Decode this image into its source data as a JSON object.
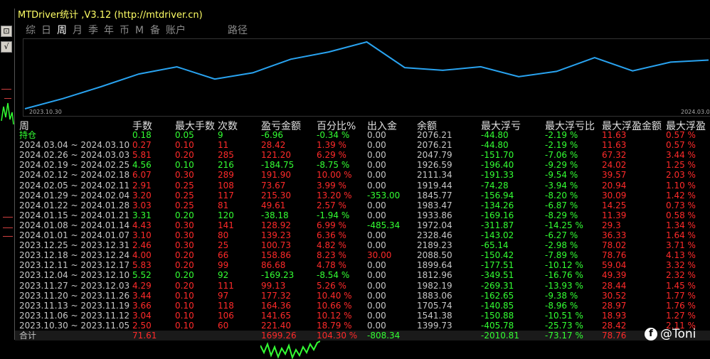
{
  "window": {
    "title": "MTDriver统计 ,V3.12 (http://mtdriver.cn)"
  },
  "side_buttons": [
    "⊡",
    "√"
  ],
  "tabs": [
    {
      "label": "综",
      "active": false
    },
    {
      "label": "日",
      "active": false
    },
    {
      "label": "周",
      "active": true
    },
    {
      "label": "月",
      "active": false
    },
    {
      "label": "季",
      "active": false
    },
    {
      "label": "年",
      "active": false
    },
    {
      "label": "币",
      "active": false
    },
    {
      "label": "M",
      "active": false
    },
    {
      "label": "备",
      "active": false
    },
    {
      "label": "账户",
      "active": false
    },
    {
      "label": "路径",
      "active": false
    }
  ],
  "chart_data": {
    "type": "line",
    "x_start_label": "2023.10.30",
    "x_end_label": "2024.03.0",
    "series": [
      {
        "color": "#29a3f0",
        "values": [
          1399.73,
          1541.38,
          1705.74,
          1883.06,
          1982.19,
          1812.96,
          1899.64,
          2088.5,
          2189.23,
          2328.46,
          1972.04,
          1933.86,
          1983.47,
          1845.77,
          1919.44,
          2111.34,
          1926.59,
          2047.79,
          2076.21
        ]
      }
    ]
  },
  "table": {
    "headers": [
      "周",
      "手数",
      "最大手数",
      "次数",
      "盈亏金额",
      "百分比%",
      "出入金",
      "余额",
      "最大浮亏",
      "最大浮亏比",
      "最大浮盈金额",
      "最大浮盈"
    ],
    "rows": [
      {
        "period": "持仓",
        "lots": "0.18",
        "max_lots": "0.05",
        "count": "9",
        "pnl": "-6.96",
        "pct": "-0.34 %",
        "deposit": "0.00",
        "balance": "2076.21",
        "max_float_loss": "-44.80",
        "max_float_loss_pct": "-2.19 %",
        "max_float_profit": "11.63",
        "max_float_profit_pct": "0.57 %",
        "pnl_color": "green"
      },
      {
        "period": "2024.03.04 ~ 2024.03.10",
        "lots": "0.27",
        "max_lots": "0.10",
        "count": "11",
        "pnl": "28.42",
        "pct": "1.39 %",
        "deposit": "0.00",
        "balance": "2076.21",
        "max_float_loss": "-44.80",
        "max_float_loss_pct": "-2.19 %",
        "max_float_profit": "11.63",
        "max_float_profit_pct": "0.57 %",
        "pnl_color": "red"
      },
      {
        "period": "2024.02.26 ~ 2024.03.03",
        "lots": "5.81",
        "max_lots": "0.20",
        "count": "285",
        "pnl": "121.20",
        "pct": "6.29 %",
        "deposit": "0.00",
        "balance": "2047.79",
        "max_float_loss": "-151.70",
        "max_float_loss_pct": "-7.06 %",
        "max_float_profit": "67.32",
        "max_float_profit_pct": "3.44 %",
        "pnl_color": "red"
      },
      {
        "period": "2024.02.19 ~ 2024.02.25",
        "lots": "4.56",
        "max_lots": "0.10",
        "count": "216",
        "pnl": "-184.75",
        "pct": "-8.75 %",
        "deposit": "0.00",
        "balance": "1926.59",
        "max_float_loss": "-196.40",
        "max_float_loss_pct": "-9.29 %",
        "max_float_profit": "24.02",
        "max_float_profit_pct": "1.25 %",
        "pnl_color": "green"
      },
      {
        "period": "2024.02.12 ~ 2024.02.18",
        "lots": "6.07",
        "max_lots": "0.30",
        "count": "289",
        "pnl": "191.90",
        "pct": "10.00 %",
        "deposit": "0.00",
        "balance": "2111.34",
        "max_float_loss": "-191.33",
        "max_float_loss_pct": "-9.54 %",
        "max_float_profit": "39.57",
        "max_float_profit_pct": "2.03 %",
        "pnl_color": "red"
      },
      {
        "period": "2024.02.05 ~ 2024.02.11",
        "lots": "2.91",
        "max_lots": "0.25",
        "count": "108",
        "pnl": "73.67",
        "pct": "3.99 %",
        "deposit": "0.00",
        "balance": "1919.44",
        "max_float_loss": "-74.28",
        "max_float_loss_pct": "-3.94 %",
        "max_float_profit": "20.94",
        "max_float_profit_pct": "1.10 %",
        "pnl_color": "red"
      },
      {
        "period": "2024.01.29 ~ 2024.02.04",
        "lots": "3.20",
        "max_lots": "0.25",
        "count": "117",
        "pnl": "215.30",
        "pct": "13.20 %",
        "deposit": "-353.00",
        "balance": "1845.77",
        "max_float_loss": "-156.94",
        "max_float_loss_pct": "-8.20 %",
        "max_float_profit": "30.09",
        "max_float_profit_pct": "1.42 %",
        "pnl_color": "red",
        "deposit_color": "green"
      },
      {
        "period": "2024.01.22 ~ 2024.01.28",
        "lots": "3.03",
        "max_lots": "0.25",
        "count": "81",
        "pnl": "49.61",
        "pct": "2.57 %",
        "deposit": "0.00",
        "balance": "1983.47",
        "max_float_loss": "-134.26",
        "max_float_loss_pct": "-6.87 %",
        "max_float_profit": "14.25",
        "max_float_profit_pct": "0.73 %",
        "pnl_color": "red"
      },
      {
        "period": "2024.01.15 ~ 2024.01.21",
        "lots": "3.31",
        "max_lots": "0.20",
        "count": "120",
        "pnl": "-38.18",
        "pct": "-1.94 %",
        "deposit": "0.00",
        "balance": "1933.86",
        "max_float_loss": "-169.16",
        "max_float_loss_pct": "-8.29 %",
        "max_float_profit": "11.39",
        "max_float_profit_pct": "0.58 %",
        "pnl_color": "green"
      },
      {
        "period": "2024.01.08 ~ 2024.01.14",
        "lots": "4.43",
        "max_lots": "0.30",
        "count": "141",
        "pnl": "128.92",
        "pct": "6.99 %",
        "deposit": "-485.34",
        "balance": "1972.04",
        "max_float_loss": "-311.87",
        "max_float_loss_pct": "-14.25 %",
        "max_float_profit": "29.3",
        "max_float_profit_pct": "1.34 %",
        "pnl_color": "red",
        "deposit_color": "green"
      },
      {
        "period": "2024.01.01 ~ 2024.01.07",
        "lots": "3.10",
        "max_lots": "0.30",
        "count": "80",
        "pnl": "139.23",
        "pct": "6.36 %",
        "deposit": "0.00",
        "balance": "2328.46",
        "max_float_loss": "-143.02",
        "max_float_loss_pct": "-6.27 %",
        "max_float_profit": "36.33",
        "max_float_profit_pct": "1.64 %",
        "pnl_color": "red"
      },
      {
        "period": "2023.12.25 ~ 2023.12.31",
        "lots": "2.46",
        "max_lots": "0.30",
        "count": "25",
        "pnl": "100.73",
        "pct": "4.82 %",
        "deposit": "0.00",
        "balance": "2189.23",
        "max_float_loss": "-65.14",
        "max_float_loss_pct": "-2.98 %",
        "max_float_profit": "78.02",
        "max_float_profit_pct": "3.71 %",
        "pnl_color": "red"
      },
      {
        "period": "2023.12.18 ~ 2023.12.24",
        "lots": "4.00",
        "max_lots": "0.20",
        "count": "66",
        "pnl": "158.86",
        "pct": "8.23 %",
        "deposit": "30.00",
        "balance": "2088.50",
        "max_float_loss": "-150.42",
        "max_float_loss_pct": "-7.89 %",
        "max_float_profit": "78.76",
        "max_float_profit_pct": "4.13 %",
        "pnl_color": "red",
        "deposit_color": "red"
      },
      {
        "period": "2023.12.11 ~ 2023.12.17",
        "lots": "5.83",
        "max_lots": "0.20",
        "count": "99",
        "pnl": "86.68",
        "pct": "4.78 %",
        "deposit": "0.00",
        "balance": "1899.64",
        "max_float_loss": "-177.51",
        "max_float_loss_pct": "-10.12 %",
        "max_float_profit": "59.04",
        "max_float_profit_pct": "3.32 %",
        "pnl_color": "red"
      },
      {
        "period": "2023.12.04 ~ 2023.12.10",
        "lots": "5.52",
        "max_lots": "0.20",
        "count": "92",
        "pnl": "-169.23",
        "pct": "-8.54 %",
        "deposit": "0.00",
        "balance": "1812.96",
        "max_float_loss": "-349.51",
        "max_float_loss_pct": "-16.76 %",
        "max_float_profit": "49.39",
        "max_float_profit_pct": "2.32 %",
        "pnl_color": "green"
      },
      {
        "period": "2023.11.27 ~ 2023.12.03",
        "lots": "4.29",
        "max_lots": "0.20",
        "count": "111",
        "pnl": "99.13",
        "pct": "5.26 %",
        "deposit": "0.00",
        "balance": "1982.19",
        "max_float_loss": "-269.31",
        "max_float_loss_pct": "-13.93 %",
        "max_float_profit": "28.44",
        "max_float_profit_pct": "1.45 %",
        "pnl_color": "red"
      },
      {
        "period": "2023.11.20 ~ 2023.11.26",
        "lots": "3.44",
        "max_lots": "0.10",
        "count": "97",
        "pnl": "177.32",
        "pct": "10.40 %",
        "deposit": "0.00",
        "balance": "1883.06",
        "max_float_loss": "-162.65",
        "max_float_loss_pct": "-9.38 %",
        "max_float_profit": "30.52",
        "max_float_profit_pct": "1.77 %",
        "pnl_color": "red"
      },
      {
        "period": "2023.11.13 ~ 2023.11.19",
        "lots": "3.66",
        "max_lots": "0.10",
        "count": "118",
        "pnl": "164.36",
        "pct": "10.66 %",
        "deposit": "0.00",
        "balance": "1705.74",
        "max_float_loss": "-140.85",
        "max_float_loss_pct": "-8.96 %",
        "max_float_profit": "28.97",
        "max_float_profit_pct": "1.76 %",
        "pnl_color": "red"
      },
      {
        "period": "2023.11.06 ~ 2023.11.12",
        "lots": "3.04",
        "max_lots": "0.10",
        "count": "106",
        "pnl": "141.65",
        "pct": "10.12 %",
        "deposit": "0.00",
        "balance": "1541.38",
        "max_float_loss": "-150.88",
        "max_float_loss_pct": "-10.51 %",
        "max_float_profit": "18.93",
        "max_float_profit_pct": "1.27 %",
        "pnl_color": "red"
      },
      {
        "period": "2023.10.30 ~ 2023.11.05",
        "lots": "2.50",
        "max_lots": "0.10",
        "count": "60",
        "pnl": "221.40",
        "pct": "18.79 %",
        "deposit": "0.00",
        "balance": "1399.73",
        "max_float_loss": "-405.78",
        "max_float_loss_pct": "-25.73 %",
        "max_float_profit": "28.42",
        "max_float_profit_pct": "2.11 %",
        "pnl_color": "red"
      },
      {
        "period": "合计",
        "lots": "71.61",
        "max_lots": "",
        "count": "",
        "pnl": "1699.26",
        "pct": "104.30 %",
        "deposit": "-808.34",
        "balance": "",
        "max_float_loss": "-2010.81",
        "max_float_loss_pct": "-73.17 %",
        "max_float_profit": "78.76",
        "max_float_profit_pct": "",
        "pnl_color": "red",
        "deposit_color": "green"
      }
    ]
  },
  "watermark": {
    "icon": "facebook-icon",
    "text": "@Toni"
  }
}
